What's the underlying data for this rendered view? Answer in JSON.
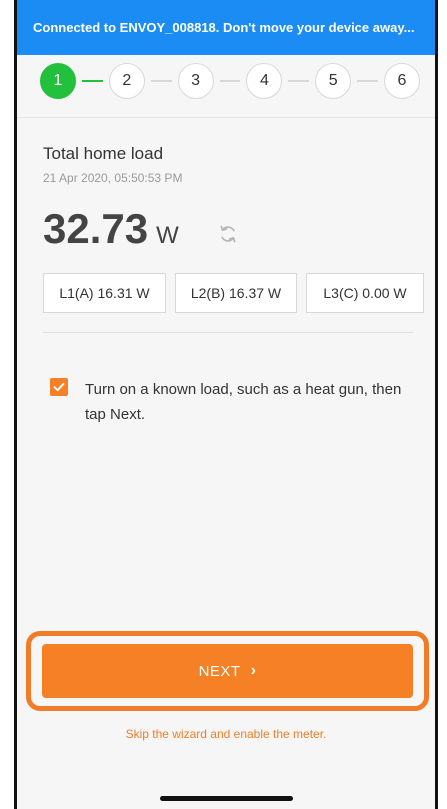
{
  "banner": {
    "text": "Connected to ENVOY_008818. Don't move your device away..."
  },
  "stepper": {
    "steps": [
      "1",
      "2",
      "3",
      "4",
      "5",
      "6"
    ],
    "current": 1
  },
  "load": {
    "title": "Total home load",
    "timestamp": "21 Apr 2020, 05:50:53 PM",
    "value": "32.73",
    "unit": "W",
    "phases": [
      {
        "label": "L1(A) 16.31 W"
      },
      {
        "label": "L2(B) 16.37 W"
      },
      {
        "label": "L3(C) 0.00 W"
      }
    ]
  },
  "instruction": {
    "checked": true,
    "text": "Turn on a known load, such as a heat gun, then tap Next."
  },
  "actions": {
    "next_label": "NEXT",
    "next_icon": "chevron-right-icon",
    "skip_label": "Skip the wizard and enable the meter."
  },
  "colors": {
    "banner": "#1a8cf3",
    "accent_orange": "#f58025",
    "step_active_green": "#22c03c"
  }
}
